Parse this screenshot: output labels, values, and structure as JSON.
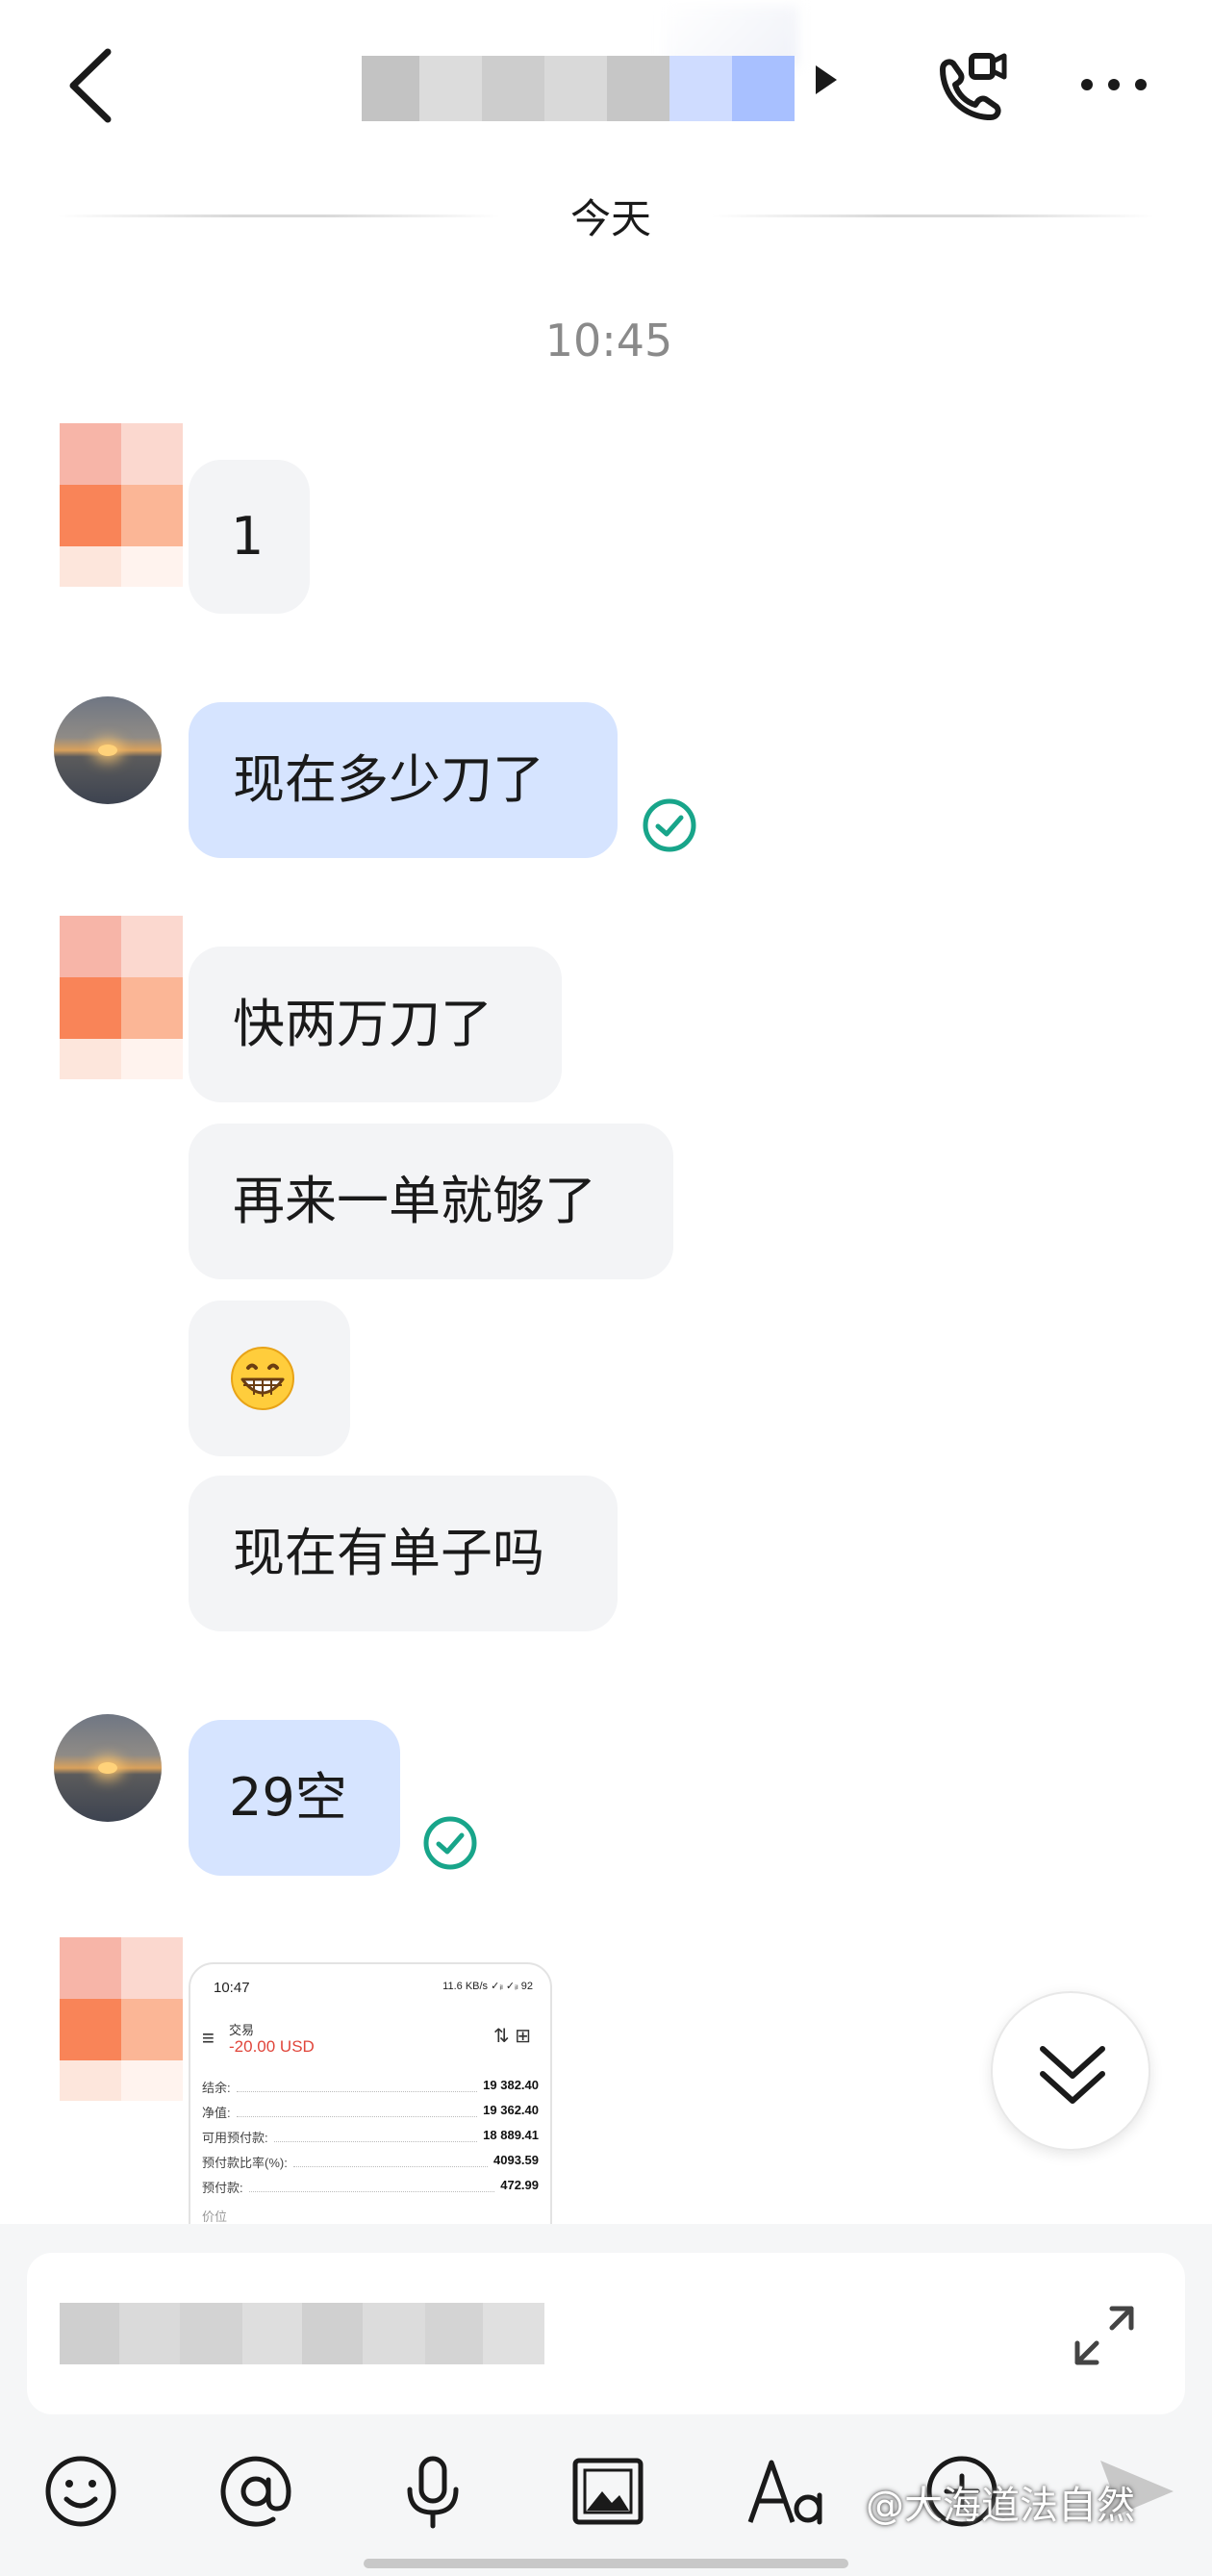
{
  "header": {
    "back_icon": "chevron-left-icon",
    "title_obscured": true,
    "call_icon": "video-call-icon",
    "more_icon": "more-icon"
  },
  "chat": {
    "date_divider": "今天",
    "time_stamp": "10:45",
    "messages": [
      {
        "side": "in",
        "text": "1"
      },
      {
        "side": "out",
        "text": "现在多少刀了",
        "read": true
      },
      {
        "side": "in",
        "text": "快两万刀了"
      },
      {
        "side": "in",
        "text": "再来一单就够了"
      },
      {
        "side": "in",
        "text": "😁"
      },
      {
        "side": "in",
        "text": "现在有单子吗"
      },
      {
        "side": "out",
        "text": "29空",
        "read": true
      },
      {
        "side": "in",
        "type": "image"
      }
    ],
    "image_message": {
      "time": "10:47",
      "status": "11.6 KB/s ✓ᵢₗ ✓ᵢₗ 92",
      "title": "交易",
      "amount": "-20.00 USD",
      "rows": [
        {
          "label": "结余:",
          "value": "19 382.40"
        },
        {
          "label": "净值:",
          "value": "19 362.40"
        },
        {
          "label": "可用预付款:",
          "value": "18 889.41"
        },
        {
          "label": "预付款比率(%):",
          "value": "4093.59"
        },
        {
          "label": "预付款:",
          "value": "472.99"
        }
      ],
      "footer": "价位"
    }
  },
  "composer": {
    "input_obscured": true,
    "expand_icon": "expand-icon",
    "toolbar": [
      "emoji-icon",
      "mention-icon",
      "microphone-icon",
      "image-icon",
      "text-format-icon",
      "add-icon",
      "send-icon"
    ]
  },
  "watermark": "@大海道法自然",
  "colors": {
    "outgoing_bubble": "#d6e4ff",
    "incoming_bubble": "#f3f4f6",
    "read_check": "#18a58a",
    "negative_amount": "#e0453a"
  }
}
